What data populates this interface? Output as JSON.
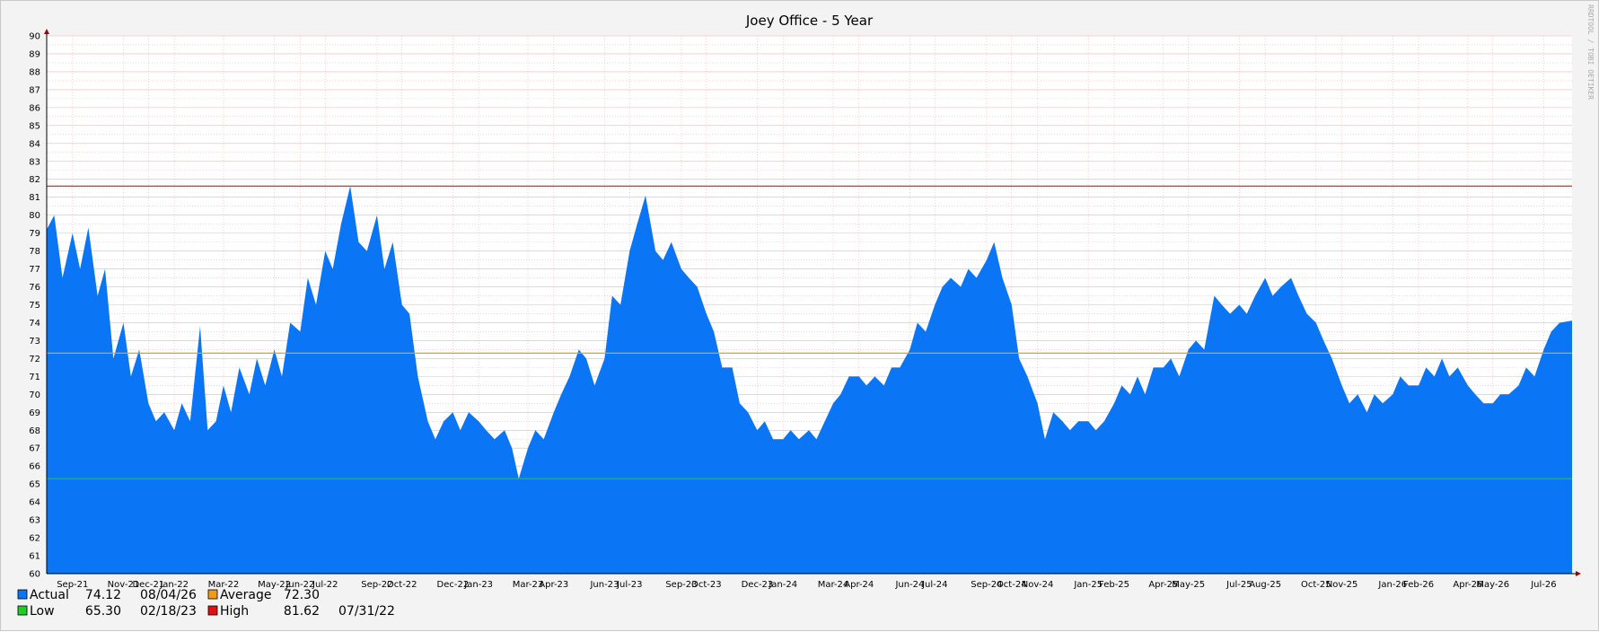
{
  "chart_data": {
    "type": "area",
    "title": "Joey Office - 5 Year",
    "watermark": "RRDTOOL / TOBI OETIKER",
    "xlabel": "",
    "ylabel": "",
    "ylim": [
      60,
      90
    ],
    "yticks": [
      60,
      61,
      62,
      63,
      64,
      65,
      66,
      67,
      68,
      69,
      70,
      71,
      72,
      73,
      74,
      75,
      76,
      77,
      78,
      79,
      80,
      81,
      82,
      83,
      84,
      85,
      86,
      87,
      88,
      89,
      90
    ],
    "grid": true,
    "legend_position": "bottom-left",
    "x_start": "2021-08-01",
    "x_end": "2026-08-04",
    "x_ticks": [
      {
        "date": "2021-09-01",
        "label": "Sep-21"
      },
      {
        "date": "2021-11-01",
        "label": "Nov-21"
      },
      {
        "date": "2021-12-01",
        "label": "Dec-21"
      },
      {
        "date": "2022-01-01",
        "label": "Jan-22"
      },
      {
        "date": "2022-03-01",
        "label": "Mar-22"
      },
      {
        "date": "2022-05-01",
        "label": "May-22"
      },
      {
        "date": "2022-06-01",
        "label": "Jun-22"
      },
      {
        "date": "2022-07-01",
        "label": "Jul-22"
      },
      {
        "date": "2022-09-01",
        "label": "Sep-22"
      },
      {
        "date": "2022-10-01",
        "label": "Oct-22"
      },
      {
        "date": "2022-12-01",
        "label": "Dec-22"
      },
      {
        "date": "2023-01-01",
        "label": "Jan-23"
      },
      {
        "date": "2023-03-01",
        "label": "Mar-23"
      },
      {
        "date": "2023-04-01",
        "label": "Apr-23"
      },
      {
        "date": "2023-06-01",
        "label": "Jun-23"
      },
      {
        "date": "2023-07-01",
        "label": "Jul-23"
      },
      {
        "date": "2023-09-01",
        "label": "Sep-23"
      },
      {
        "date": "2023-10-01",
        "label": "Oct-23"
      },
      {
        "date": "2023-12-01",
        "label": "Dec-23"
      },
      {
        "date": "2024-01-01",
        "label": "Jan-24"
      },
      {
        "date": "2024-03-01",
        "label": "Mar-24"
      },
      {
        "date": "2024-04-01",
        "label": "Apr-24"
      },
      {
        "date": "2024-06-01",
        "label": "Jun-24"
      },
      {
        "date": "2024-07-01",
        "label": "Jul-24"
      },
      {
        "date": "2024-09-01",
        "label": "Sep-24"
      },
      {
        "date": "2024-10-01",
        "label": "Oct-24"
      },
      {
        "date": "2024-11-01",
        "label": "Nov-24"
      },
      {
        "date": "2025-01-01",
        "label": "Jan-25"
      },
      {
        "date": "2025-02-01",
        "label": "Feb-25"
      },
      {
        "date": "2025-04-01",
        "label": "Apr-25"
      },
      {
        "date": "2025-05-01",
        "label": "May-25"
      },
      {
        "date": "2025-07-01",
        "label": "Jul-25"
      },
      {
        "date": "2025-08-01",
        "label": "Aug-25"
      },
      {
        "date": "2025-10-01",
        "label": "Oct-25"
      },
      {
        "date": "2025-11-01",
        "label": "Nov-25"
      },
      {
        "date": "2026-01-01",
        "label": "Jan-26"
      },
      {
        "date": "2026-02-01",
        "label": "Feb-26"
      },
      {
        "date": "2026-04-01",
        "label": "Apr-26"
      },
      {
        "date": "2026-05-01",
        "label": "May-26"
      },
      {
        "date": "2026-07-01",
        "label": "Jul-26"
      }
    ],
    "series": [
      {
        "name": "Actual",
        "color": "#0a76f5",
        "points": [
          [
            "2021-08-01",
            79.2
          ],
          [
            "2021-08-10",
            80.0
          ],
          [
            "2021-08-20",
            76.5
          ],
          [
            "2021-09-01",
            79.0
          ],
          [
            "2021-09-10",
            77.0
          ],
          [
            "2021-09-20",
            79.3
          ],
          [
            "2021-10-01",
            75.5
          ],
          [
            "2021-10-10",
            77.0
          ],
          [
            "2021-10-20",
            72.0
          ],
          [
            "2021-11-01",
            74.0
          ],
          [
            "2021-11-10",
            71.0
          ],
          [
            "2021-11-20",
            72.5
          ],
          [
            "2021-12-01",
            69.5
          ],
          [
            "2021-12-10",
            68.5
          ],
          [
            "2021-12-20",
            69.0
          ],
          [
            "2022-01-01",
            68.0
          ],
          [
            "2022-01-10",
            69.5
          ],
          [
            "2022-01-20",
            68.5
          ],
          [
            "2022-02-01",
            73.8
          ],
          [
            "2022-02-10",
            68.0
          ],
          [
            "2022-02-20",
            68.5
          ],
          [
            "2022-03-01",
            70.5
          ],
          [
            "2022-03-10",
            69.0
          ],
          [
            "2022-03-20",
            71.5
          ],
          [
            "2022-04-01",
            70.0
          ],
          [
            "2022-04-10",
            72.0
          ],
          [
            "2022-04-20",
            70.5
          ],
          [
            "2022-05-01",
            72.5
          ],
          [
            "2022-05-10",
            71.0
          ],
          [
            "2022-05-20",
            74.0
          ],
          [
            "2022-06-01",
            73.5
          ],
          [
            "2022-06-10",
            76.5
          ],
          [
            "2022-06-20",
            75.0
          ],
          [
            "2022-07-01",
            78.0
          ],
          [
            "2022-07-10",
            77.0
          ],
          [
            "2022-07-20",
            79.5
          ],
          [
            "2022-07-31",
            81.62
          ],
          [
            "2022-08-10",
            78.5
          ],
          [
            "2022-08-20",
            78.0
          ],
          [
            "2022-09-01",
            80.0
          ],
          [
            "2022-09-10",
            77.0
          ],
          [
            "2022-09-20",
            78.5
          ],
          [
            "2022-10-01",
            75.0
          ],
          [
            "2022-10-10",
            74.5
          ],
          [
            "2022-10-20",
            71.0
          ],
          [
            "2022-11-01",
            68.5
          ],
          [
            "2022-11-10",
            67.5
          ],
          [
            "2022-11-20",
            68.5
          ],
          [
            "2022-12-01",
            69.0
          ],
          [
            "2022-12-10",
            68.0
          ],
          [
            "2022-12-20",
            69.0
          ],
          [
            "2023-01-01",
            68.5
          ],
          [
            "2023-01-10",
            68.0
          ],
          [
            "2023-01-20",
            67.5
          ],
          [
            "2023-02-01",
            68.0
          ],
          [
            "2023-02-10",
            67.0
          ],
          [
            "2023-02-18",
            65.3
          ],
          [
            "2023-03-01",
            67.0
          ],
          [
            "2023-03-10",
            68.0
          ],
          [
            "2023-03-20",
            67.5
          ],
          [
            "2023-04-01",
            69.0
          ],
          [
            "2023-04-10",
            70.0
          ],
          [
            "2023-04-20",
            71.0
          ],
          [
            "2023-05-01",
            72.5
          ],
          [
            "2023-05-10",
            72.0
          ],
          [
            "2023-05-20",
            70.5
          ],
          [
            "2023-06-01",
            72.0
          ],
          [
            "2023-06-10",
            75.5
          ],
          [
            "2023-06-20",
            75.0
          ],
          [
            "2023-07-01",
            78.0
          ],
          [
            "2023-07-10",
            79.5
          ],
          [
            "2023-07-20",
            81.1
          ],
          [
            "2023-08-01",
            78.0
          ],
          [
            "2023-08-10",
            77.5
          ],
          [
            "2023-08-20",
            78.5
          ],
          [
            "2023-09-01",
            77.0
          ],
          [
            "2023-09-10",
            76.5
          ],
          [
            "2023-09-20",
            76.0
          ],
          [
            "2023-10-01",
            74.5
          ],
          [
            "2023-10-10",
            73.5
          ],
          [
            "2023-10-20",
            71.5
          ],
          [
            "2023-11-01",
            71.5
          ],
          [
            "2023-11-10",
            69.5
          ],
          [
            "2023-11-20",
            69.0
          ],
          [
            "2023-12-01",
            68.0
          ],
          [
            "2023-12-10",
            68.5
          ],
          [
            "2023-12-20",
            67.5
          ],
          [
            "2024-01-01",
            67.5
          ],
          [
            "2024-01-10",
            68.0
          ],
          [
            "2024-01-20",
            67.5
          ],
          [
            "2024-02-01",
            68.0
          ],
          [
            "2024-02-10",
            67.5
          ],
          [
            "2024-02-20",
            68.5
          ],
          [
            "2024-03-01",
            69.5
          ],
          [
            "2024-03-10",
            70.0
          ],
          [
            "2024-03-20",
            71.0
          ],
          [
            "2024-04-01",
            71.0
          ],
          [
            "2024-04-10",
            70.5
          ],
          [
            "2024-04-20",
            71.0
          ],
          [
            "2024-05-01",
            70.5
          ],
          [
            "2024-05-10",
            71.5
          ],
          [
            "2024-05-20",
            71.5
          ],
          [
            "2024-06-01",
            72.5
          ],
          [
            "2024-06-10",
            74.0
          ],
          [
            "2024-06-20",
            73.5
          ],
          [
            "2024-07-01",
            75.0
          ],
          [
            "2024-07-10",
            76.0
          ],
          [
            "2024-07-20",
            76.5
          ],
          [
            "2024-08-01",
            76.0
          ],
          [
            "2024-08-10",
            77.0
          ],
          [
            "2024-08-20",
            76.5
          ],
          [
            "2024-09-01",
            77.5
          ],
          [
            "2024-09-10",
            78.5
          ],
          [
            "2024-09-20",
            76.5
          ],
          [
            "2024-10-01",
            75.0
          ],
          [
            "2024-10-10",
            72.0
          ],
          [
            "2024-10-20",
            71.0
          ],
          [
            "2024-11-01",
            69.5
          ],
          [
            "2024-11-10",
            67.5
          ],
          [
            "2024-11-20",
            69.0
          ],
          [
            "2024-12-01",
            68.5
          ],
          [
            "2024-12-10",
            68.0
          ],
          [
            "2024-12-20",
            68.5
          ],
          [
            "2025-01-01",
            68.5
          ],
          [
            "2025-01-10",
            68.0
          ],
          [
            "2025-01-20",
            68.5
          ],
          [
            "2025-02-01",
            69.5
          ],
          [
            "2025-02-10",
            70.5
          ],
          [
            "2025-02-20",
            70.0
          ],
          [
            "2025-03-01",
            71.0
          ],
          [
            "2025-03-10",
            70.0
          ],
          [
            "2025-03-20",
            71.5
          ],
          [
            "2025-04-01",
            71.5
          ],
          [
            "2025-04-10",
            72.0
          ],
          [
            "2025-04-20",
            71.0
          ],
          [
            "2025-05-01",
            72.5
          ],
          [
            "2025-05-10",
            73.0
          ],
          [
            "2025-05-20",
            72.5
          ],
          [
            "2025-06-01",
            75.5
          ],
          [
            "2025-06-10",
            75.0
          ],
          [
            "2025-06-20",
            74.5
          ],
          [
            "2025-07-01",
            75.0
          ],
          [
            "2025-07-10",
            74.5
          ],
          [
            "2025-07-20",
            75.5
          ],
          [
            "2025-08-01",
            76.5
          ],
          [
            "2025-08-10",
            75.5
          ],
          [
            "2025-08-20",
            76.0
          ],
          [
            "2025-09-01",
            76.5
          ],
          [
            "2025-09-10",
            75.5
          ],
          [
            "2025-09-20",
            74.5
          ],
          [
            "2025-10-01",
            74.0
          ],
          [
            "2025-10-10",
            73.0
          ],
          [
            "2025-10-20",
            72.0
          ],
          [
            "2025-11-01",
            70.5
          ],
          [
            "2025-11-10",
            69.5
          ],
          [
            "2025-11-20",
            70.0
          ],
          [
            "2025-12-01",
            69.0
          ],
          [
            "2025-12-10",
            70.0
          ],
          [
            "2025-12-20",
            69.5
          ],
          [
            "2026-01-01",
            70.0
          ],
          [
            "2026-01-10",
            71.0
          ],
          [
            "2026-01-20",
            70.5
          ],
          [
            "2026-02-01",
            70.5
          ],
          [
            "2026-02-10",
            71.5
          ],
          [
            "2026-02-20",
            71.0
          ],
          [
            "2026-03-01",
            72.0
          ],
          [
            "2026-03-10",
            71.0
          ],
          [
            "2026-03-20",
            71.5
          ],
          [
            "2026-04-01",
            70.5
          ],
          [
            "2026-04-10",
            70.0
          ],
          [
            "2026-04-20",
            69.5
          ],
          [
            "2026-05-01",
            69.5
          ],
          [
            "2026-05-10",
            70.0
          ],
          [
            "2026-05-20",
            70.0
          ],
          [
            "2026-06-01",
            70.5
          ],
          [
            "2026-06-10",
            71.5
          ],
          [
            "2026-06-20",
            71.0
          ],
          [
            "2026-07-01",
            72.5
          ],
          [
            "2026-07-10",
            73.5
          ],
          [
            "2026-07-20",
            74.0
          ],
          [
            "2026-08-04",
            74.12
          ]
        ]
      }
    ],
    "reference_lines": [
      {
        "name": "Average",
        "value": 72.3,
        "color": "#e8a200"
      },
      {
        "name": "Low",
        "value": 65.3,
        "color": "#22cc22"
      },
      {
        "name": "High",
        "value": 81.62,
        "color": "#e01010"
      }
    ],
    "legend": [
      {
        "name": "Actual",
        "value": "74.12",
        "date": "08/04/26",
        "color": "#0a76f5"
      },
      {
        "name": "Average",
        "value": "72.30",
        "date": "",
        "color": "#f09a1a"
      },
      {
        "name": "Low",
        "value": "65.30",
        "date": "02/18/23",
        "color": "#22cc22"
      },
      {
        "name": "High",
        "value": "81.62",
        "date": "07/31/22",
        "color": "#e01010"
      }
    ]
  }
}
